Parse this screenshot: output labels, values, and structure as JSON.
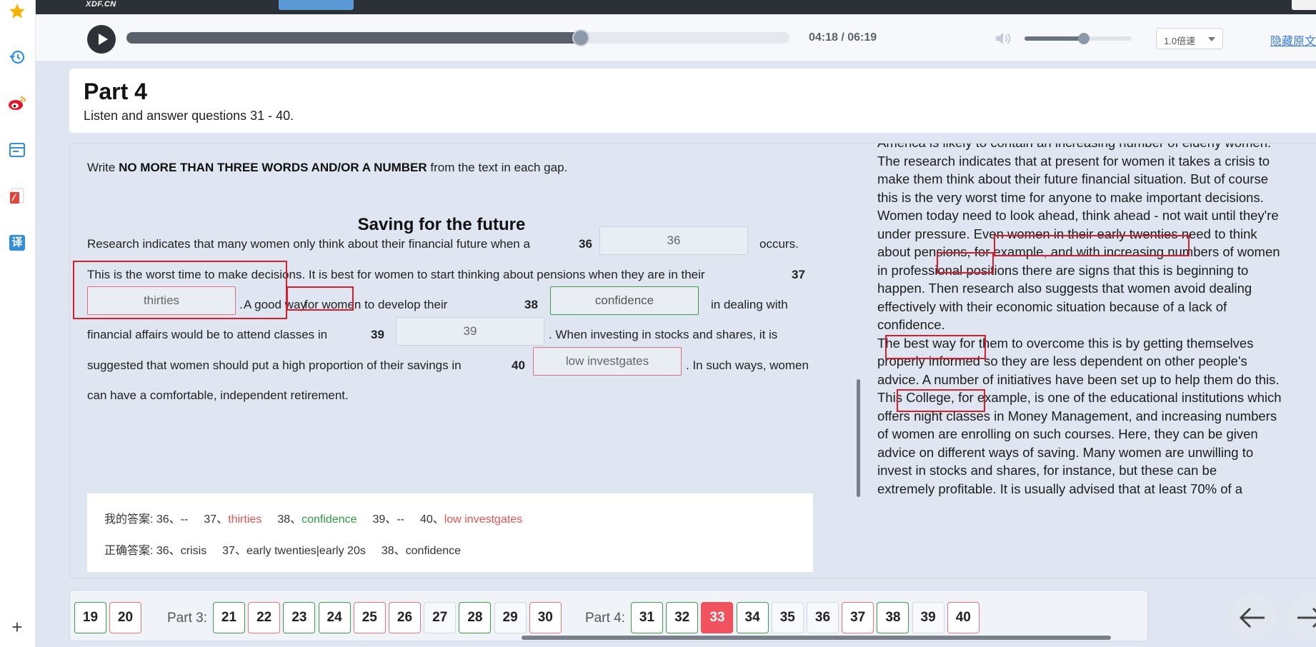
{
  "sidebar": {
    "icons": [
      "star-icon",
      "history-icon",
      "weibo-icon",
      "window-icon",
      "pdf-icon",
      "translate-icon",
      "plus-icon"
    ],
    "translate_glyph": "译",
    "plus_glyph": "+"
  },
  "topbar": {
    "logo": "XDF.CN"
  },
  "player": {
    "progress": 0.685,
    "time": "04:18 / 06:19",
    "volume": 0.55,
    "speed": "1.0倍速",
    "hide_text": "隐藏原文"
  },
  "part": {
    "title": "Part 4",
    "subtitle": "Listen and answer questions 31 - 40."
  },
  "questions": {
    "instruction_pre": "Write ",
    "instruction_bold": "NO MORE THAN THREE WORDS AND/OR A NUMBER",
    "instruction_post": " from the text in each gap.",
    "passage_title": "Saving for the future",
    "l1": "Research indicates that many women only think about their financial future when a",
    "n36": "36",
    "gap36": "36",
    "l1b": "occurs.",
    "l2": "This is the worst time to make decisions. It is best for women to start thinking about pensions when they are in their",
    "n37": "37",
    "gap37": "thirties",
    "l3a": ".",
    "l3b": "A good way",
    "l3c": "for women to develop their",
    "n38": "38",
    "gap38": "confidence",
    "l3d": "in dealing with",
    "l4a": "financial affairs would be to attend classes in",
    "n39": "39",
    "gap39": "39",
    "l4b": ". When investing in stocks and shares, it is",
    "l5a": "suggested that women should put a high proportion of their savings in",
    "n40": "40",
    "gap40": "low investgates",
    "l5b": ". In such ways, women",
    "l6": "can have a comfortable, independent retirement."
  },
  "answers": {
    "mine_label": "我的答案:",
    "mine": [
      {
        "q": "36、",
        "a": "--",
        "status": "none"
      },
      {
        "q": "37、",
        "a": "thirties",
        "status": "wrong"
      },
      {
        "q": "38、",
        "a": "confidence",
        "status": "right"
      },
      {
        "q": "39、",
        "a": "--",
        "status": "none"
      },
      {
        "q": "40、",
        "a": "low investgates",
        "status": "wrong"
      }
    ],
    "correct_label": "正确答案:",
    "correct": [
      {
        "q": "36、",
        "a": "crisis"
      },
      {
        "q": "37、",
        "a": "early twenties|early 20s"
      },
      {
        "q": "38、",
        "a": "confidence"
      }
    ]
  },
  "transcript": {
    "lines": [
      "America is likely to contain an increasing number of elderly women.",
      "The research indicates that at present for women it takes a crisis to",
      "make them think about their future financial situation. But of course",
      "this is the very worst time for anyone to make important decisions.",
      "Women today need to look ahead, think ahead - not wait until they're",
      "under pressure. Even women in their early twenties need to think",
      "about pensions, for example, and with increasing numbers of women",
      "in professional positions there are signs that this is beginning to",
      "happen. Then research also suggests that women avoid dealing",
      "effectively with their economic situation because of a lack of",
      "confidence.",
      "The best way for them to overcome this is by getting themselves",
      "properly informed so they are less dependent on other people's",
      "advice. A number of initiatives have been set up to help them do this.",
      "This College, for example, is one of the educational institutions which",
      "offers night classes in Money Management, and increasing numbers",
      "of women are enrolling on such courses. Here, they can be given",
      "advice on different ways of saving. Many women are unwilling to",
      "invest in stocks and shares, for instance, but these can be",
      "extremely profitable. It is usually advised that at least 70% of a"
    ]
  },
  "nav": {
    "part3_label": "Part 3:",
    "part4_label": "Part 4:",
    "items": [
      {
        "n": "19",
        "s": "g"
      },
      {
        "n": "20",
        "s": "r"
      },
      {
        "n": "21",
        "s": "g"
      },
      {
        "n": "22",
        "s": "r"
      },
      {
        "n": "23",
        "s": "g"
      },
      {
        "n": "24",
        "s": "g"
      },
      {
        "n": "25",
        "s": "r"
      },
      {
        "n": "26",
        "s": "r"
      },
      {
        "n": "27",
        "s": "n"
      },
      {
        "n": "28",
        "s": "g"
      },
      {
        "n": "29",
        "s": "n"
      },
      {
        "n": "30",
        "s": "r"
      },
      {
        "n": "31",
        "s": "g"
      },
      {
        "n": "32",
        "s": "g"
      },
      {
        "n": "33",
        "s": "cur"
      },
      {
        "n": "34",
        "s": "g"
      },
      {
        "n": "35",
        "s": "n"
      },
      {
        "n": "36",
        "s": "n"
      },
      {
        "n": "37",
        "s": "r"
      },
      {
        "n": "38",
        "s": "g"
      },
      {
        "n": "39",
        "s": "n"
      },
      {
        "n": "40",
        "s": "r"
      }
    ]
  }
}
